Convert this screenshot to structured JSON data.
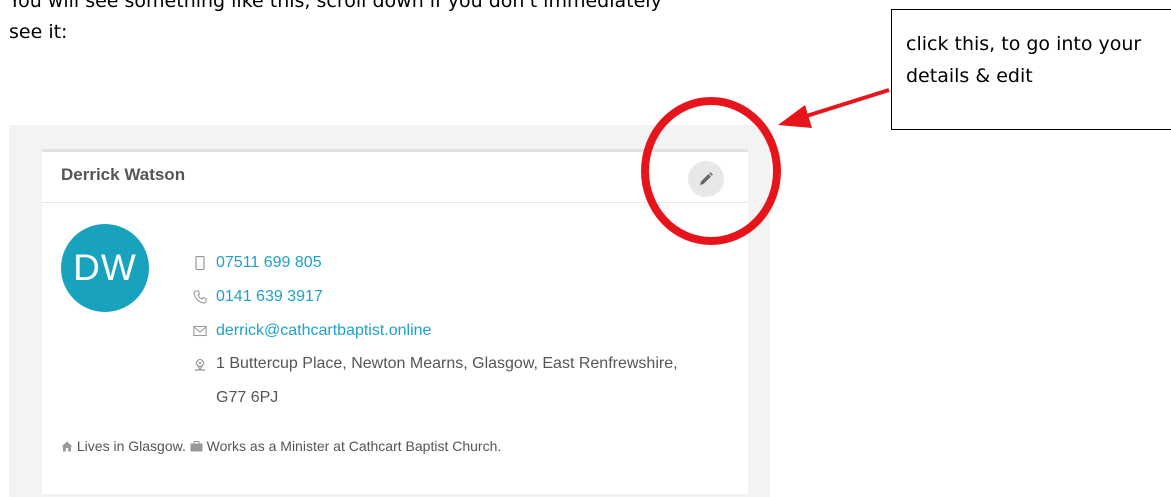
{
  "instruction": {
    "line1": "You will see something like this, scroll down if you don't immediately",
    "line2": "see it:"
  },
  "callout": {
    "text": "click this, to go into your details & edit"
  },
  "profile": {
    "name": "Derrick Watson",
    "initials": "DW",
    "avatar_color": "#18a2bd",
    "mobile": "07511 699 805",
    "phone": "0141 639 3917",
    "email": "derrick@cathcartbaptist.online",
    "address": "1 Buttercup Place, Newton Mearns, Glasgow, East Renfrewshire, G77 6PJ",
    "lives": "Lives in Glasgow.",
    "works": "Works as a Minister at Cathcart Baptist Church.",
    "icons": [
      "mobile-icon",
      "phone-icon",
      "email-icon",
      "location-icon",
      "home-icon",
      "briefcase-icon",
      "pencil-icon"
    ]
  },
  "colors": {
    "link": "#1ea2c4",
    "annotation": "#e8141b"
  }
}
